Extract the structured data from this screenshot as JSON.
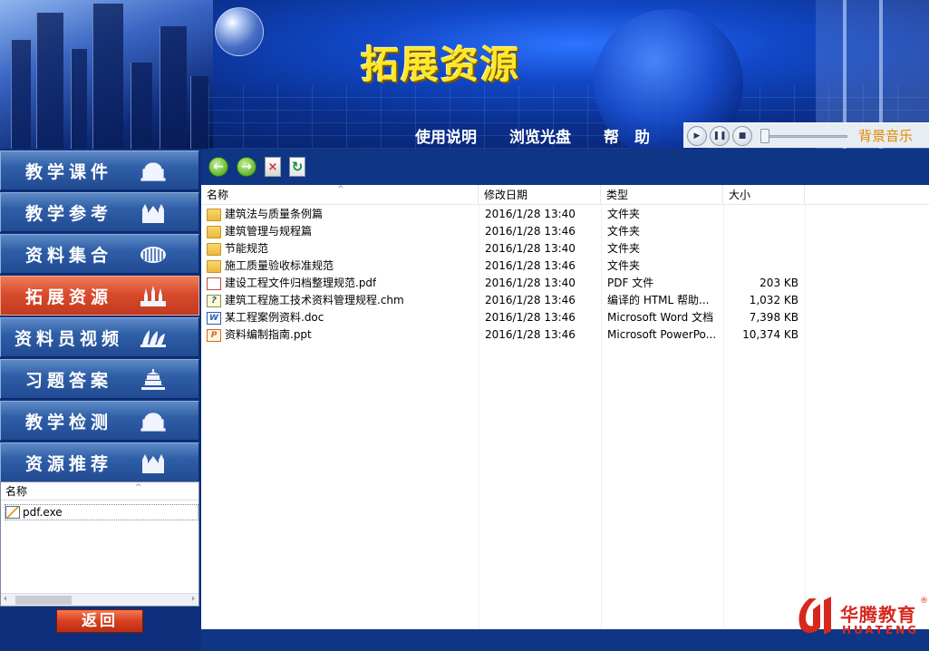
{
  "app": {
    "title": "拓展资源"
  },
  "top_nav": [
    {
      "label": "使用说明"
    },
    {
      "label": "浏览光盘"
    },
    {
      "label": "帮　助"
    }
  ],
  "music": {
    "label": "背景音乐",
    "volume_fraction": 0.0,
    "play_icon": "play-icon",
    "pause_icon": "pause-icon",
    "stop_icon": "stop-icon"
  },
  "sidebar": {
    "items": [
      {
        "label": "教学课件",
        "icon": "dome-building-icon",
        "active": false
      },
      {
        "label": "教学参考",
        "icon": "cathedral-icon",
        "active": false
      },
      {
        "label": "资料集合",
        "icon": "colosseum-icon",
        "active": false
      },
      {
        "label": "拓展资源",
        "icon": "kremlin-icon",
        "active": true
      },
      {
        "label": "资料员视频",
        "icon": "opera-house-icon",
        "active": false
      },
      {
        "label": "习题答案",
        "icon": "temple-of-heaven-icon",
        "active": false
      },
      {
        "label": "教学检测",
        "icon": "dome-building-icon",
        "active": false
      },
      {
        "label": "资源推荐",
        "icon": "cathedral-icon",
        "active": false
      }
    ],
    "small_list": {
      "header": "名称",
      "rows": [
        {
          "name": "pdf.exe"
        }
      ]
    },
    "back_label": "返回"
  },
  "toolbar": {
    "back_icon": "back-arrow-icon",
    "forward_icon": "forward-arrow-icon",
    "stop_icon": "stop-icon",
    "refresh_icon": "refresh-icon"
  },
  "file_list": {
    "columns": {
      "name": "名称",
      "date": "修改日期",
      "type": "类型",
      "size": "大小"
    },
    "rows": [
      {
        "icon": "folder",
        "name": "建筑法与质量条例篇",
        "date": "2016/1/28 13:40",
        "type": "文件夹",
        "size": ""
      },
      {
        "icon": "folder",
        "name": "建筑管理与规程篇",
        "date": "2016/1/28 13:46",
        "type": "文件夹",
        "size": ""
      },
      {
        "icon": "folder",
        "name": "节能规范",
        "date": "2016/1/28 13:40",
        "type": "文件夹",
        "size": ""
      },
      {
        "icon": "folder",
        "name": "施工质量验收标准规范",
        "date": "2016/1/28 13:46",
        "type": "文件夹",
        "size": ""
      },
      {
        "icon": "pdf",
        "name": "建设工程文件归档整理规范.pdf",
        "date": "2016/1/28 13:40",
        "type": "PDF 文件",
        "size": "203 KB"
      },
      {
        "icon": "chm",
        "name": "建筑工程施工技术资料管理规程.chm",
        "date": "2016/1/28 13:46",
        "type": "编译的 HTML 帮助...",
        "size": "1,032 KB"
      },
      {
        "icon": "doc",
        "name": "某工程案例资料.doc",
        "date": "2016/1/28 13:46",
        "type": "Microsoft Word 文档",
        "size": "7,398 KB"
      },
      {
        "icon": "ppt",
        "name": "资料编制指南.ppt",
        "date": "2016/1/28 13:46",
        "type": "Microsoft PowerPo...",
        "size": "10,374 KB"
      }
    ]
  },
  "logo": {
    "cn": "华腾教育",
    "en": "HUATENG",
    "reg": "®"
  },
  "colors": {
    "accent_active": "#d94b2c",
    "sidebar_blue": "#2f5fa8",
    "title_yellow": "#ffe72a",
    "music_label": "#e08a00",
    "logo_red": "#d7281e"
  }
}
